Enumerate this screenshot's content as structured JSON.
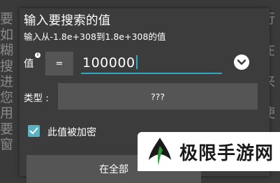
{
  "background": {
    "left_chars": [
      "要",
      "如",
      "糊",
      "搜",
      "进",
      "您",
      "用",
      "要",
      "窗"
    ],
    "right_chars": [
      "行",
      "",
      "在",
      "",
      "来",
      "",
      "使",
      "",
      ""
    ]
  },
  "dialog": {
    "title": "输入要搜索的值",
    "subtitle": "输入从-1.8e+308到1.8e+308的值",
    "value_label": "值",
    "info_icon_glyph": "i",
    "operator_label": "=",
    "input_value": "100000",
    "type_label": "类型 :",
    "type_value": "???",
    "checkbox_label": "此值被加密",
    "checkbox_checked": true,
    "bottom_button_label": "在全部"
  },
  "watermark": {
    "text": "极限手游网"
  },
  "colors": {
    "accent": "#2fa8c0",
    "checkbox": "#5bb0c2",
    "dialog_bg": "#3c3c3c",
    "field_bg": "#555555",
    "logo_green": "#2a9a3a",
    "logo_dark": "#1a1a1a"
  }
}
